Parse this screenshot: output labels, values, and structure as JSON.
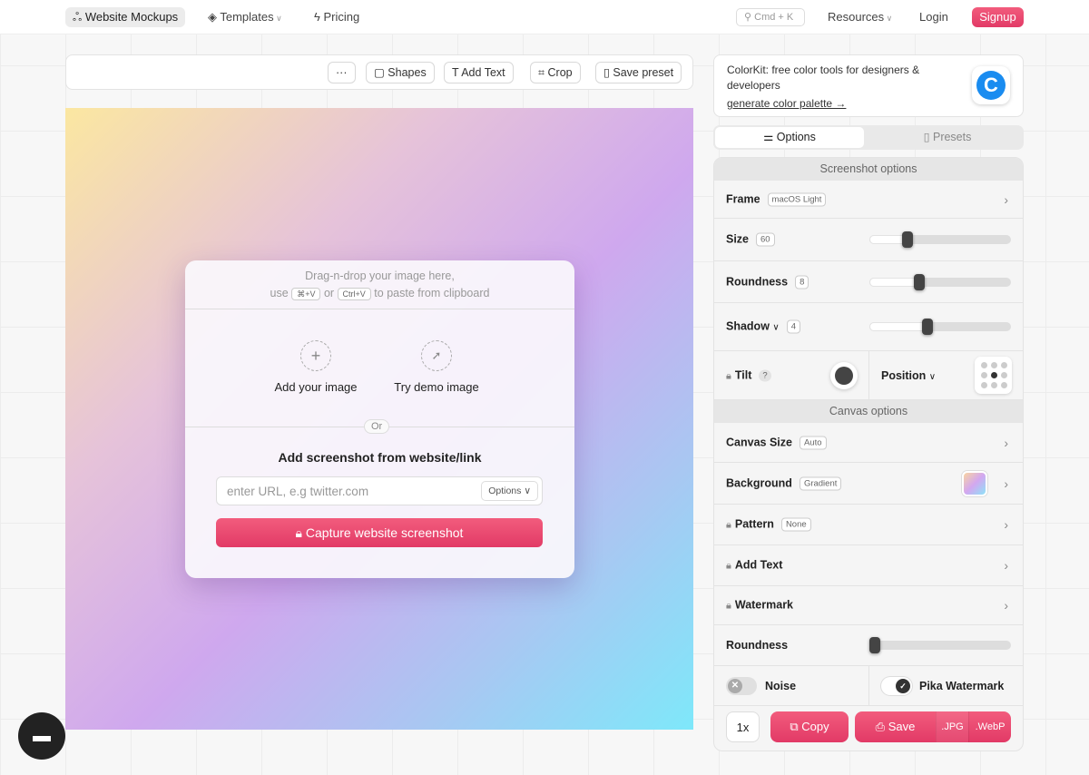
{
  "nav": {
    "items": [
      {
        "label": "Website Mockups",
        "icon": "mockups-icon"
      },
      {
        "label": "Templates",
        "icon": "templates-icon"
      },
      {
        "label": "Pricing",
        "icon": "bolt-icon"
      }
    ],
    "search": "Cmd + K",
    "resources": "Resources",
    "login": "Login",
    "signup": "Signup"
  },
  "toolbar": {
    "more": "···",
    "shapes": "Shapes",
    "add_text": "Add Text",
    "crop": "Crop",
    "save_preset": "Save preset"
  },
  "drop": {
    "line1": "Drag-n-drop your image here,",
    "use": "use",
    "key_mac": "⌘+V",
    "or": "or",
    "key_win": "Ctrl+V",
    "line2_end": "to paste from clipboard",
    "add_image": "Add your image",
    "demo_image": "Try demo image",
    "divider": "Or",
    "website_title": "Add screenshot from website/link",
    "url_placeholder": "enter URL, e.g twitter.com",
    "options": "Options",
    "capture": "Capture website screenshot"
  },
  "ad": {
    "text": "ColorKit: free color tools for designers & developers",
    "link": "generate color palette →"
  },
  "tabs": {
    "options": "Options",
    "presets": "Presets"
  },
  "screenshot": {
    "header": "Screenshot options",
    "frame": {
      "label": "Frame",
      "value": "macOS Light"
    },
    "size": {
      "label": "Size",
      "value": "60",
      "slider": 0.27
    },
    "roundness": {
      "label": "Roundness",
      "value": "8",
      "slider": 0.35
    },
    "shadow": {
      "label": "Shadow",
      "value": "4",
      "slider": 0.41
    },
    "tilt": {
      "label": "Tilt",
      "help": "?"
    },
    "position": {
      "label": "Position",
      "selected": "center"
    }
  },
  "canvas": {
    "header": "Canvas options",
    "size": {
      "label": "Canvas Size",
      "value": "Auto"
    },
    "background": {
      "label": "Background",
      "value": "Gradient"
    },
    "pattern": {
      "label": "Pattern",
      "value": "None"
    },
    "add_text": {
      "label": "Add Text"
    },
    "watermark": {
      "label": "Watermark"
    },
    "roundness": {
      "label": "Roundness",
      "slider": 0
    },
    "noise": {
      "label": "Noise",
      "on": false
    },
    "pika_watermark": {
      "label": "Pika Watermark",
      "on": true
    }
  },
  "actions": {
    "scale": "1x",
    "copy": "Copy",
    "save": "Save",
    "jpg": ".JPG",
    "webp": ".WebP"
  },
  "colors": {
    "accent": "#e8416c"
  }
}
